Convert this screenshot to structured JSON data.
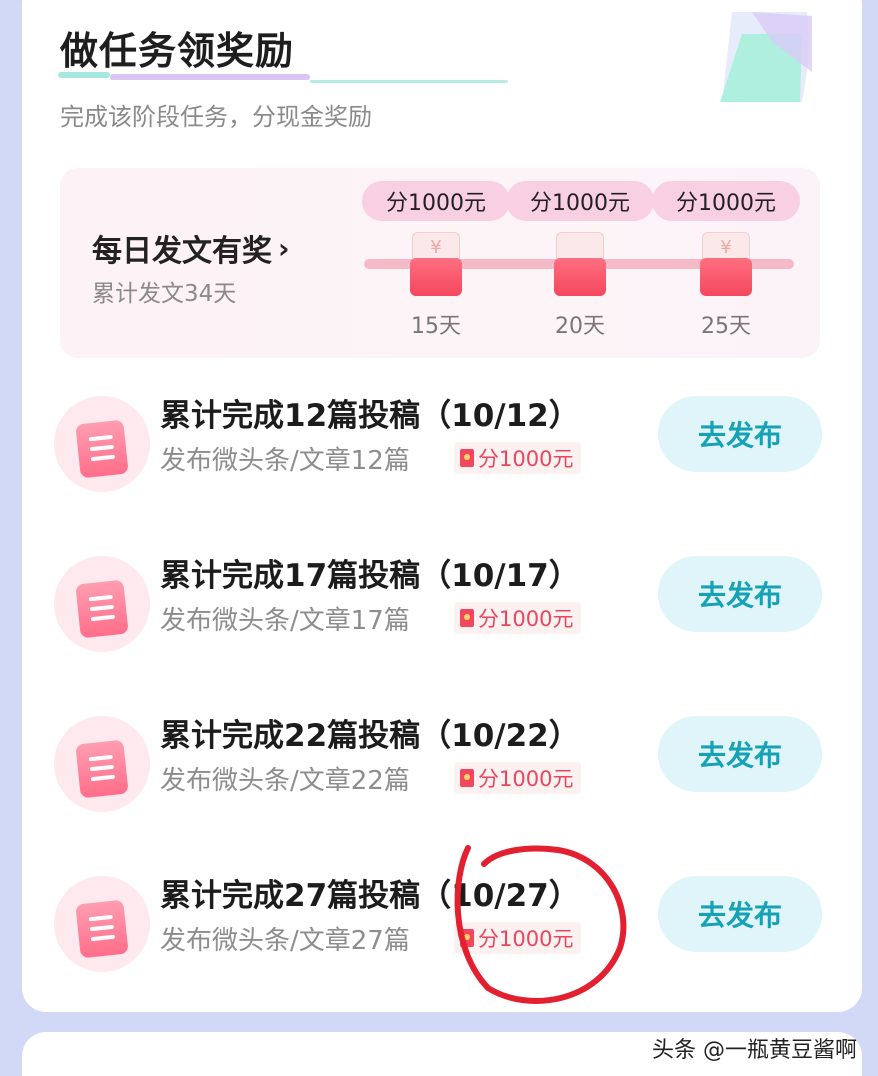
{
  "section": {
    "title": "做任务领奖励",
    "subtitle": "完成该阶段任务，分现金奖励"
  },
  "daily": {
    "title": "每日发文有奖",
    "progress_text": "累计发文34天",
    "milestones": [
      {
        "reward": "分1000元",
        "day": "15天"
      },
      {
        "reward": "分1000元",
        "day": "20天"
      },
      {
        "reward": "分1000元",
        "day": "25天"
      }
    ]
  },
  "tasks": [
    {
      "title": "累计完成12篇投稿（10/12）",
      "desc": "发布微头条/文章12篇",
      "reward": "分1000元",
      "button": "去发布"
    },
    {
      "title": "累计完成17篇投稿（10/17）",
      "desc": "发布微头条/文章17篇",
      "reward": "分1000元",
      "button": "去发布"
    },
    {
      "title": "累计完成22篇投稿（10/22）",
      "desc": "发布微头条/文章22篇",
      "reward": "分1000元",
      "button": "去发布"
    },
    {
      "title": "累计完成27篇投稿（10/27）",
      "desc": "发布微头条/文章27篇",
      "reward": "分1000元",
      "button": "去发布"
    }
  ],
  "watermark": "头条 @一瓶黄豆酱啊",
  "colors": {
    "accent": "#17a1b4",
    "reward": "#e8475d",
    "annotation": "#e3202f"
  }
}
